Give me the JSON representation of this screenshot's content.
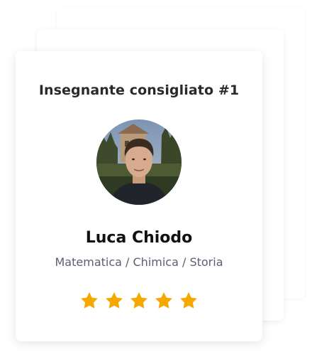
{
  "card": {
    "title": "Insegnante consigliato #1",
    "teacher_name": "Luca Chiodo",
    "subjects": "Matematica / Chimica / Storia",
    "rating": {
      "value": 5,
      "max": 5
    }
  },
  "colors": {
    "star": "#f5a800",
    "title": "#2a2a2e",
    "subjects": "#5a5f73"
  },
  "icons": {
    "rating": "star-icon",
    "avatar": "teacher-photo"
  }
}
